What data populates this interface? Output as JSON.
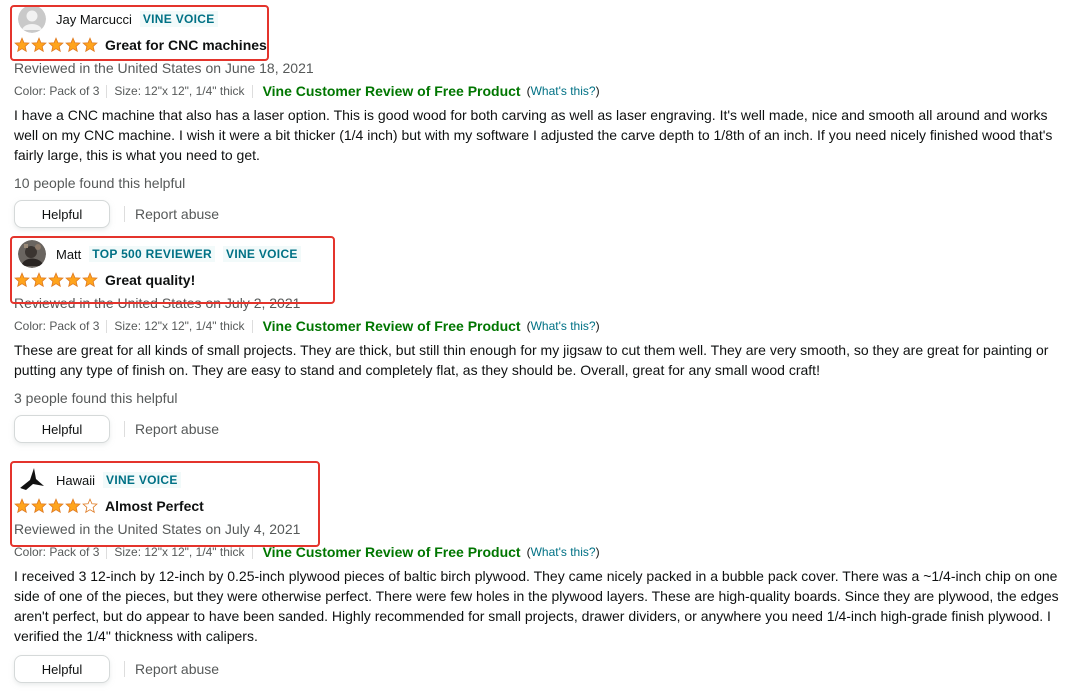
{
  "reviews": [
    {
      "name": "Jay Marcucci",
      "badges": [
        "VINE VOICE"
      ],
      "rating": 5,
      "title": "Great for CNC machines",
      "meta": "Reviewed in the United States on June 18, 2021",
      "color": "Color: Pack of 3",
      "size": "Size: 12\"x 12\", 1/4\" thick",
      "vine_label": "Vine Customer Review of Free Product",
      "whats_open": "(",
      "whats_link": "What's this?",
      "whats_close": ")",
      "body": "I have a CNC machine that also has a laser option. This is good wood for both carving as well as laser engraving. It's well made, nice and smooth all around and works well on my CNC machine. I wish it were a bit thicker (1/4 inch) but with my software I adjusted the carve depth to 1/8th of an inch. If you need nicely finished wood that's fairly large, this is what you need to get.",
      "helpful_count": "10 people found this helpful",
      "helpful_label": "Helpful",
      "report_label": "Report abuse"
    },
    {
      "name": "Matt",
      "badges": [
        "TOP 500 REVIEWER",
        "VINE VOICE"
      ],
      "rating": 5,
      "title": "Great quality!",
      "meta": "Reviewed in the United States on July 2, 2021",
      "color": "Color: Pack of 3",
      "size": "Size: 12\"x 12\", 1/4\" thick",
      "vine_label": "Vine Customer Review of Free Product",
      "whats_open": "(",
      "whats_link": "What's this?",
      "whats_close": ")",
      "body": "These are great for all kinds of small projects. They are thick, but still thin enough for my jigsaw to cut them well. They are very smooth, so they are great for painting or putting any type of finish on. They are easy to stand and completely flat, as they should be. Overall, great for any small wood craft!",
      "helpful_count": "3 people found this helpful",
      "helpful_label": "Helpful",
      "report_label": "Report abuse"
    },
    {
      "name": "Hawaii",
      "badges": [
        "VINE VOICE"
      ],
      "rating": 4,
      "title": "Almost Perfect",
      "meta": "Reviewed in the United States on July 4, 2021",
      "color": "Color: Pack of 3",
      "size": "Size: 12\"x 12\", 1/4\" thick",
      "vine_label": "Vine Customer Review of Free Product",
      "whats_open": "(",
      "whats_link": "What's this?",
      "whats_close": ")",
      "body": "I received 3 12-inch by 12-inch by 0.25-inch plywood pieces of baltic birch plywood. They came nicely packed in a bubble pack cover. There was a ~1/4-inch chip on one side of one of the pieces, but they were otherwise perfect. There were few holes in the plywood layers. These are high-quality boards. Since they are plywood, the edges aren't perfect, but do appear to have been sanded. Highly recommended for small projects, drawer dividers, or anywhere you need 1/4-inch high-grade finish plywood. I verified the 1/4\" thickness with calipers.",
      "helpful_label": "Helpful",
      "report_label": "Report abuse"
    }
  ],
  "colors": {
    "star": "#ffa41c",
    "link": "#007185",
    "vine": "#007600",
    "highlight": "#e4342c"
  }
}
